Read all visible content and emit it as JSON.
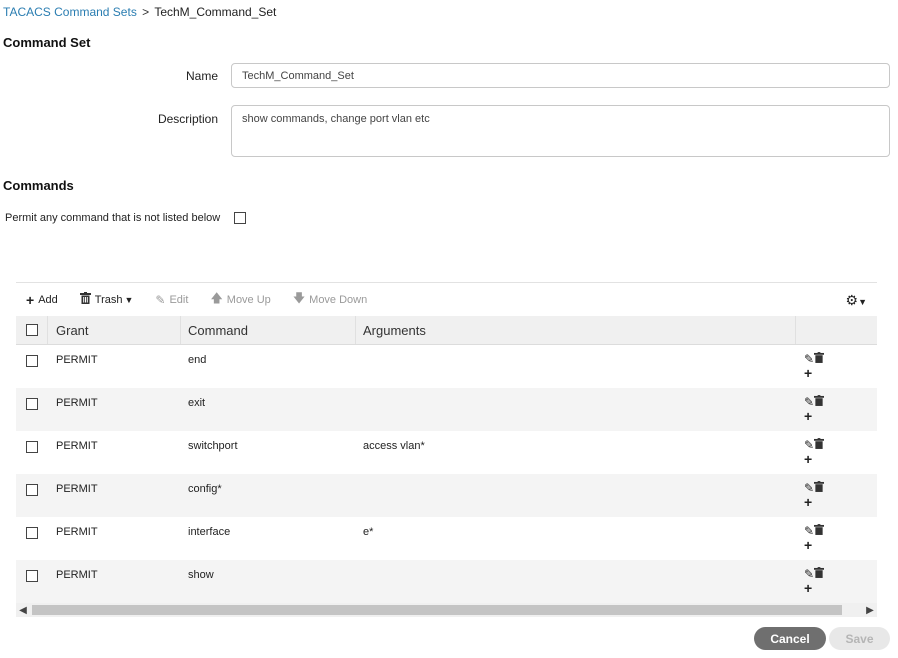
{
  "breadcrumb": {
    "parent": "TACACS Command Sets",
    "separator": ">",
    "current": "TechM_Command_Set"
  },
  "command_set": {
    "title": "Command Set",
    "name_label": "Name",
    "name_value": "TechM_Command_Set",
    "description_label": "Description",
    "description_value": "show commands, change port vlan etc"
  },
  "commands": {
    "title": "Commands",
    "permit_label": "Permit any command that is not listed below",
    "permit_checked": false
  },
  "toolbar": {
    "add": "Add",
    "trash": "Trash",
    "edit": "Edit",
    "move_up": "Move Up",
    "move_down": "Move Down"
  },
  "grid": {
    "headers": {
      "grant": "Grant",
      "command": "Command",
      "arguments": "Arguments"
    },
    "rows": [
      {
        "grant": "PERMIT",
        "command": "end",
        "arguments": ""
      },
      {
        "grant": "PERMIT",
        "command": "exit",
        "arguments": ""
      },
      {
        "grant": "PERMIT",
        "command": "switchport",
        "arguments": "access vlan*"
      },
      {
        "grant": "PERMIT",
        "command": "config*",
        "arguments": ""
      },
      {
        "grant": "PERMIT",
        "command": "interface",
        "arguments": "e*"
      },
      {
        "grant": "PERMIT",
        "command": "show",
        "arguments": ""
      }
    ]
  },
  "footer": {
    "cancel": "Cancel",
    "save": "Save"
  },
  "icons": {
    "add": "plus-icon",
    "trash": "trash-icon",
    "edit": "edit-icon",
    "move_up": "arrow-up-icon",
    "move_down": "arrow-down-icon",
    "settings": "gear-icon"
  },
  "colors": {
    "link": "#2a7db1",
    "cancel_bg": "#6f6f6f",
    "save_bg": "#e8e8e8"
  }
}
